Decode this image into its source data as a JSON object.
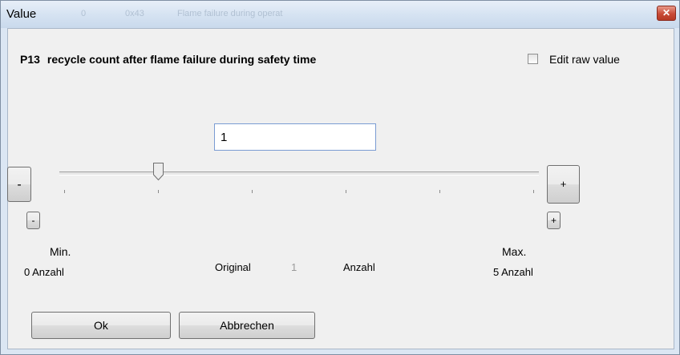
{
  "window": {
    "title": "Value",
    "background_title_fragments": [
      "0",
      "0x43",
      "Flame failure during operat"
    ]
  },
  "param": {
    "id": "P13",
    "name": "recycle count after flame failure during safety time"
  },
  "raw_value": {
    "label": "Edit raw value",
    "checked": false
  },
  "input": {
    "value": "1"
  },
  "slider": {
    "min": 0,
    "max": 5,
    "value": 1,
    "ticks": 6
  },
  "buttons": {
    "minus": "-",
    "plus": "+",
    "ok": "Ok",
    "cancel": "Abbrechen"
  },
  "range": {
    "min_label": "Min.",
    "min_value": "0 Anzahl",
    "max_label": "Max.",
    "max_value": "5 Anzahl",
    "original_label": "Original",
    "original_value": "1",
    "unit": "Anzahl"
  },
  "colors": {
    "accent_border": "#7a9cd3",
    "close_button": "#c84a36"
  }
}
